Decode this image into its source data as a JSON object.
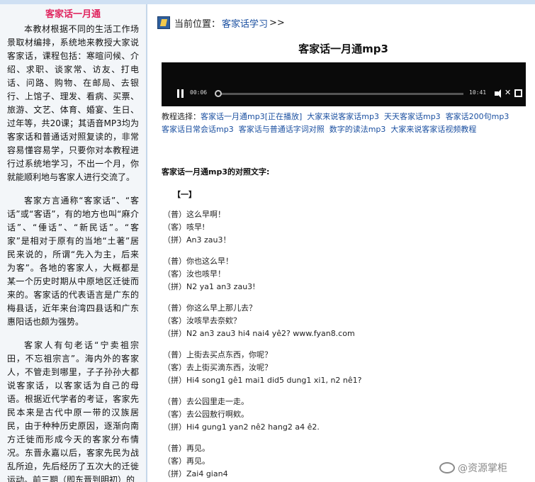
{
  "sidebar": {
    "title": "客家话一月通",
    "paragraphs": [
      "本教材根据不同的生活工作场景取材编排，系统地来教授大家说客家话，课程包括：寒暄问候、介绍、求职、谈家常、访友、打电话、问路、购物、在邮局、去银行、上馆子、理发、看病、买票、旅游、文艺、体育、婚宴、生日、过年等，共20课；其语音MP3均为客家话和普通话对照复读的，非常容易懂容易学，只要你对本教程进行过系统地学习，不出一个月，你就能顺利地与客家人进行交流了。",
      "客家方言通称“客家话”、“客话”或“客语”，有的地方也叫“麻介话”、“倕话”、“新民话”。“客家”是相对于原有的当地“土著”居民来说的，所谓“先入为主，后来为客”。各地的客家人，大概都是某一个历史时期从中原地区迁徙而来的。客家话的代表语言是广东的梅县话，近年来台湾四县话和广东惠阳话也颇为强势。",
      "客家人有句老话“宁卖祖宗田，不忘祖宗言”。海内外的客家人，不管走到哪里，子子孙孙大都说客家话，以客家话为自己的母语。根据近代学者的考证，客家先民本来是古代中原一带的汉族居民，由于种种历史原因，逐渐向南方迁徙而形成今天的客家分布情况。东晋永嘉以后，客家先民为战乱所迫，先后经历了五次大的迁徙运动。前三期（即东晋到明初）的"
    ]
  },
  "breadcrumb": {
    "label": "当前位置：",
    "link": "客家话学习",
    "sep": " >>"
  },
  "page_title": "客家话一月通mp3",
  "player": {
    "current_time": "00:06",
    "duration": "10:41",
    "progress": 0.01
  },
  "tutorials": {
    "label": "教程选择：",
    "items": [
      "客家话一月通mp3[正在播放]",
      "大家来说客家话mp3",
      "天天客家话mp3",
      "客家话200句mp3",
      "客家话日常会话mp3",
      "客家话与普通话字词对照",
      "数字的读法mp3",
      "大家来说客家话视频教程"
    ]
  },
  "section_heading": "客家话一月通mp3的对照文字:",
  "lesson_label": "【一】",
  "dialogs": [
    [
      "（普）这么早啊！",
      "（客）咳早!",
      "（拼）An3 zau3！"
    ],
    [
      "（普）你也这么早！",
      "（客）汝也咳早！",
      "（拼）N2 ya1 an3 zau3!"
    ],
    [
      "（普）你这么早上那儿去？",
      "（客）汝咳早去奈欸？",
      "（拼）N2 an3 zau3 hi4 nai4 yê2? www.fyan8.com"
    ],
    [
      "（普）上街去买点东西，你呢？",
      "（客）去上街买滴东西，汝呢？",
      "（拼）Hi4 song1 gê1 mai1 did5 dung1 xi1, n2 nê1?"
    ],
    [
      "（普）去公园里走一走。",
      "（客）去公园敖行啊欸。",
      "（拼）Hi4 gung1 yan2 nê2 hang2 a4 ê2."
    ],
    [
      "（普）再见。",
      "（客）再见。",
      "（拼）Zai4 gian4"
    ]
  ],
  "watermark": "@资源掌柜"
}
